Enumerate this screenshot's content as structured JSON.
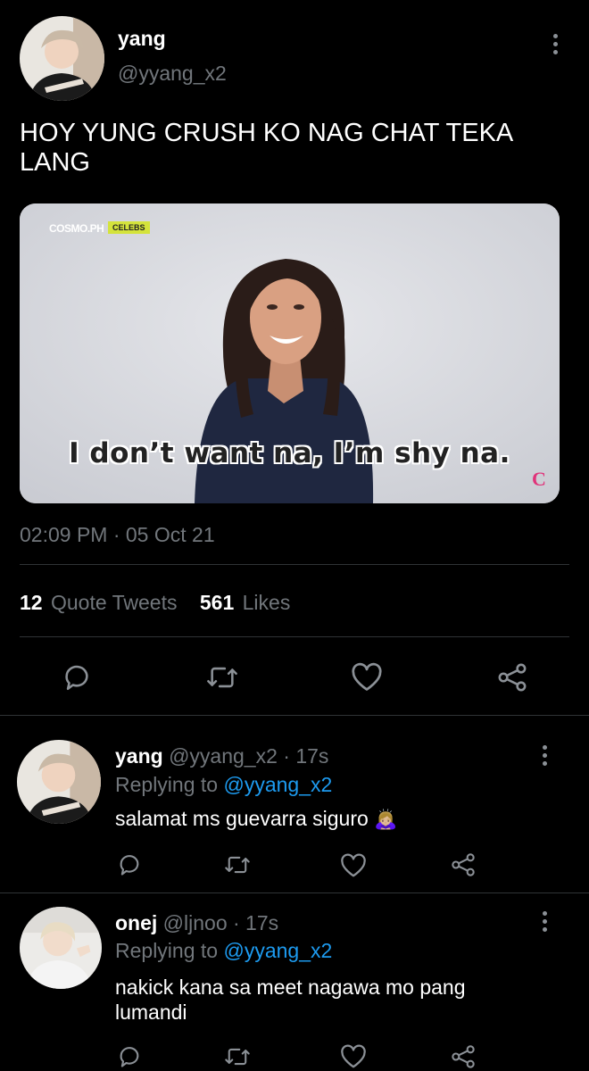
{
  "main_tweet": {
    "display_name": "yang",
    "handle": "@yyang_x2",
    "text": "HOY YUNG CRUSH KO NAG CHAT TEKA LANG",
    "media": {
      "brand": "COSMO.PH",
      "tag": "CELEBS",
      "caption": "I don’t want na, I’m shy na.",
      "corner_logo": "C"
    },
    "time": "02:09 PM · 05 Oct 21",
    "quote_count": "12",
    "quote_label": "Quote Tweets",
    "likes_count": "561",
    "likes_label": "Likes"
  },
  "replies": [
    {
      "display_name": "yang",
      "handle_time": "@yyang_x2 · 17s",
      "replying_prefix": "Replying to",
      "replying_to": "@yyang_x2",
      "text": "salamat ms guevarra siguro",
      "emoji": "🙇🏼‍♀️"
    },
    {
      "display_name": "onej",
      "handle_time": "@ljnoo · 17s",
      "replying_prefix": "Replying to",
      "replying_to": "@yyang_x2",
      "text": "nakick kana sa meet nagawa mo pang lumandi"
    }
  ],
  "icons": {
    "reply": "speech-bubble-icon",
    "retweet": "retweet-arrows-icon",
    "like": "heart-icon",
    "share": "share-nodes-icon",
    "more": "vertical-dots-icon"
  },
  "colors": {
    "background": "#000000",
    "text": "#e7e9ea",
    "muted": "#71767b",
    "link": "#1d9bf0",
    "divider": "#2f3336"
  }
}
